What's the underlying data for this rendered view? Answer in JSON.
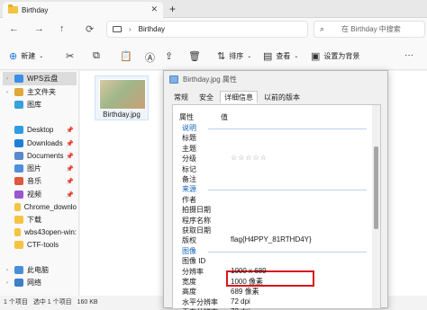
{
  "window": {
    "tab_title": "Birthday",
    "close": "✕",
    "new_tab": "+"
  },
  "nav": {
    "back": "←",
    "forward": "→",
    "up": "↑",
    "refresh": "⟳",
    "breadcrumb_sep": "›",
    "path": "Birthday",
    "search_placeholder": "在 Birthday 中搜索"
  },
  "toolbar": {
    "new_label": "新建",
    "sort_label": "排序",
    "view_label": "查看",
    "wallpaper_label": "设置为背景",
    "more": "···"
  },
  "sidebar": {
    "items": [
      {
        "label": "WPS云盘",
        "color": "#3b8ee8"
      },
      {
        "label": "主文件夹",
        "color": "#e0a73a"
      },
      {
        "label": "图库",
        "color": "#36a2d9"
      },
      {
        "label": "Desktop",
        "color": "#2f9be3"
      },
      {
        "label": "Downloads",
        "color": "#1f7fd6"
      },
      {
        "label": "Documents",
        "color": "#5a8ac9"
      },
      {
        "label": "图片",
        "color": "#4f8fdd"
      },
      {
        "label": "音乐",
        "color": "#e0573d"
      },
      {
        "label": "视频",
        "color": "#9b55cf"
      },
      {
        "label": "Chrome_downlo",
        "color": "#f5c342"
      },
      {
        "label": "下载",
        "color": "#f5c342"
      },
      {
        "label": "wbs43open-win:",
        "color": "#f5c342"
      },
      {
        "label": "CTF-tools",
        "color": "#f5c342"
      },
      {
        "label": "此电脑",
        "color": "#4a8fd6"
      },
      {
        "label": "网络",
        "color": "#3d7fc9"
      }
    ]
  },
  "file": {
    "name": "Birthday.jpg"
  },
  "status": {
    "count": "1 个项目",
    "selected": "选中 1 个项目",
    "size": "160 KB"
  },
  "dialog": {
    "title": "Birthday.jpg 属性",
    "tabs": [
      "常规",
      "安全",
      "详细信息",
      "以前的版本"
    ],
    "col_property": "属性",
    "col_value": "值",
    "rows": [
      {
        "k": "说明",
        "v": "",
        "section": true
      },
      {
        "k": "标题",
        "v": ""
      },
      {
        "k": "主题",
        "v": ""
      },
      {
        "k": "分级",
        "v": "☆☆☆☆☆",
        "stars": true
      },
      {
        "k": "标记",
        "v": ""
      },
      {
        "k": "备注",
        "v": ""
      },
      {
        "k": "来源",
        "v": "",
        "section": true
      },
      {
        "k": "作者",
        "v": ""
      },
      {
        "k": "拍摄日期",
        "v": ""
      },
      {
        "k": "程序名称",
        "v": ""
      },
      {
        "k": "获取日期",
        "v": ""
      },
      {
        "k": "版权",
        "v": "flag{H4PPY_81RTHD4Y}"
      },
      {
        "k": "图像",
        "v": "",
        "section": true
      },
      {
        "k": "图像 ID",
        "v": ""
      },
      {
        "k": "分辨率",
        "v": "1000 x 689"
      },
      {
        "k": "宽度",
        "v": "1000 像素"
      },
      {
        "k": "高度",
        "v": "689 像素"
      },
      {
        "k": "水平分辨率",
        "v": "72 dpi"
      },
      {
        "k": "垂直分辨率",
        "v": "72 dpi"
      }
    ]
  }
}
